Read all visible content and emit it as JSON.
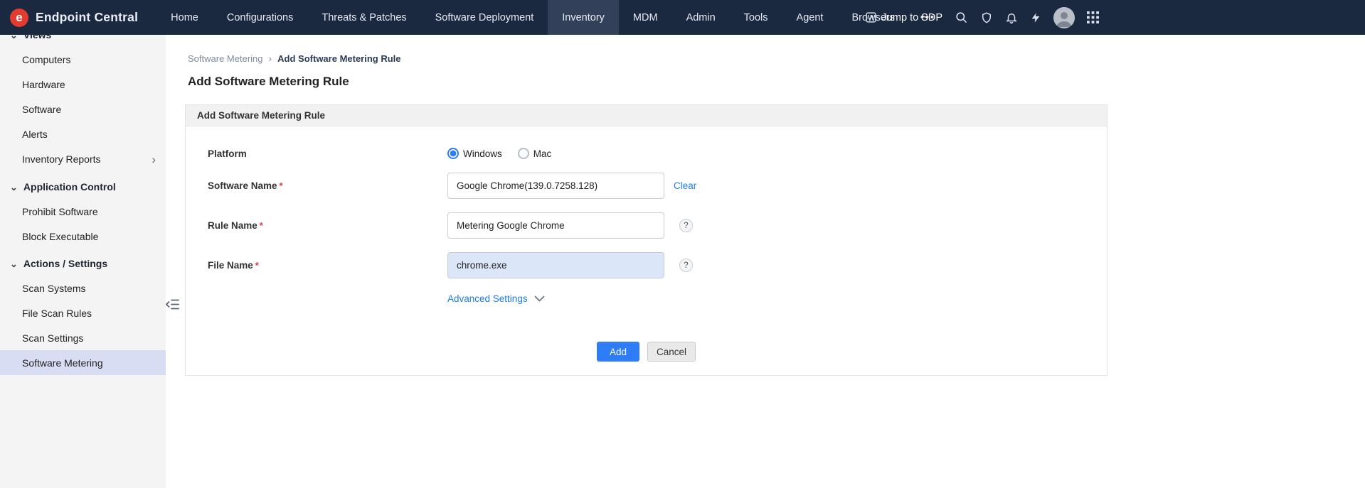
{
  "topbar": {
    "brand": "Endpoint Central",
    "nav": [
      {
        "label": "Home"
      },
      {
        "label": "Configurations"
      },
      {
        "label": "Threats & Patches"
      },
      {
        "label": "Software Deployment"
      },
      {
        "label": "Inventory"
      },
      {
        "label": "MDM"
      },
      {
        "label": "Admin"
      },
      {
        "label": "Tools"
      },
      {
        "label": "Agent"
      },
      {
        "label": "Browsers"
      },
      {
        "label": "•••"
      }
    ],
    "jump_to_sdp_label": "Jump to SDP"
  },
  "icons": {
    "chevron_down": "⌄",
    "chevron_right": "›"
  },
  "sidebar": {
    "views_heading": "Views",
    "view_items": [
      "Computers",
      "Hardware",
      "Software",
      "Alerts",
      "Inventory Reports"
    ],
    "sections": [
      {
        "title": "Application Control",
        "items": [
          "Prohibit Software",
          "Block Executable"
        ]
      },
      {
        "title": "Actions / Settings",
        "items": [
          "Scan Systems",
          "File Scan Rules",
          "Scan Settings",
          "Software Metering"
        ]
      }
    ],
    "selected_item": "Software Metering"
  },
  "breadcrumb": {
    "parent": "Software Metering",
    "separator": "›",
    "current": "Add Software Metering Rule"
  },
  "page": {
    "title": "Add Software Metering Rule"
  },
  "panel": {
    "title": "Add Software Metering Rule",
    "form": {
      "platform": {
        "label": "Platform",
        "options": [
          {
            "label": "Windows",
            "checked": "checked"
          },
          {
            "label": "Mac"
          }
        ]
      },
      "software_name": {
        "label": "Software Name",
        "required_mark": "*",
        "value": "Google Chrome(139.0.7258.128)",
        "clear_label": "Clear"
      },
      "rule_name": {
        "label": "Rule Name",
        "required_mark": "*",
        "value": "Metering Google Chrome",
        "help": "?"
      },
      "file_name": {
        "label": "File Name",
        "required_mark": "*",
        "value": "chrome.exe",
        "help": "?"
      },
      "advanced_settings_label": "Advanced Settings",
      "add_label": "Add",
      "cancel_label": "Cancel"
    }
  },
  "colors": {
    "topbar_bg": "#1a2840",
    "accent_blue": "#2e7cf6",
    "sidebar_selected_bg": "#d9ddf3",
    "required_red": "#e23b3b",
    "logo_red": "#e23c30",
    "highlighted_input_bg": "#dbe6f9"
  }
}
